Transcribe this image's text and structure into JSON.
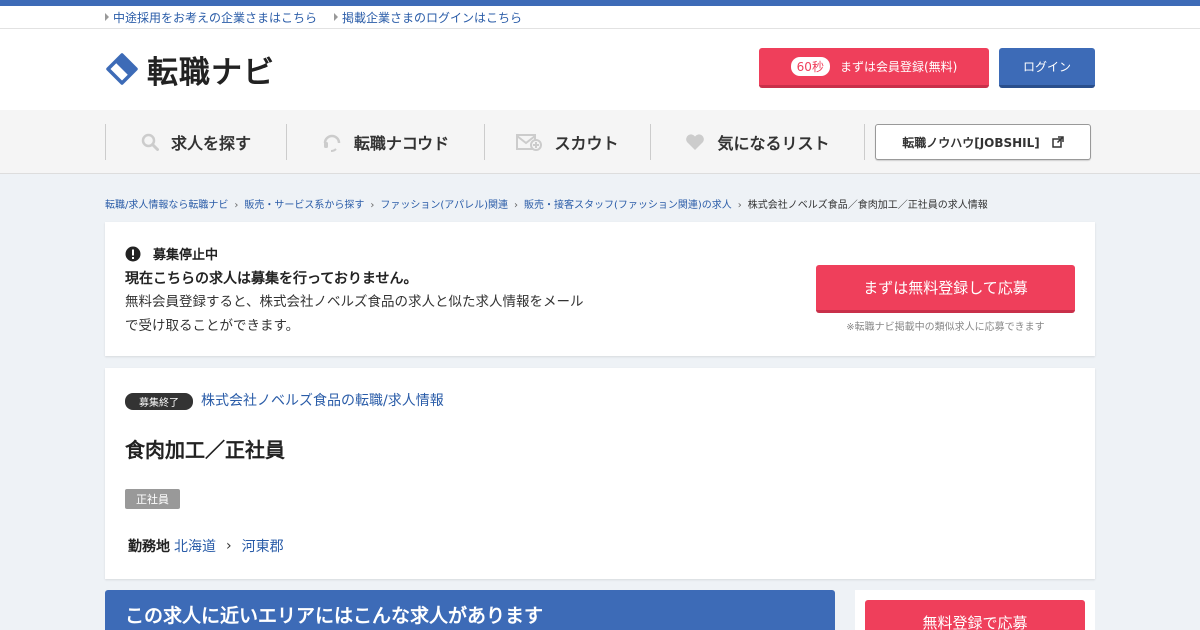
{
  "utility": {
    "links": [
      "中途採用をお考えの企業さまはこちら",
      "掲載企業さまのログインはこちら"
    ]
  },
  "header": {
    "logo_text": "転職ナビ",
    "register_badge": "60秒",
    "register_label": "まずは会員登録(無料)",
    "login_label": "ログイン"
  },
  "nav": {
    "items": [
      {
        "label": "求人を探す",
        "icon": "search-icon"
      },
      {
        "label": "転職ナコウド",
        "icon": "headset-icon"
      },
      {
        "label": "スカウト",
        "icon": "mail-plus-icon"
      },
      {
        "label": "気になるリスト",
        "icon": "heart-icon"
      }
    ],
    "jobshil_label": "転職ノウハウ[JOBSHIL]"
  },
  "breadcrumb": {
    "items": [
      "転職/求人情報なら転職ナビ",
      "販売・サービス系から探す",
      "ファッション(アパレル)関連",
      "販売・接客スタッフ(ファッション関連)の求人"
    ],
    "current": "株式会社ノベルズ食品／食肉加工／正社員の求人情報"
  },
  "notice": {
    "status": "募集停止中",
    "heading": "現在こちらの求人は募集を行っておりません。",
    "body": "無料会員登録すると、株式会社ノベルズ食品の求人と似た求人情報をメールで受け取ることができます。",
    "apply_button": "まずは無料登録して応募",
    "apply_note": "※転職ナビ掲載中の類似求人に応募できます"
  },
  "job": {
    "ended_badge": "募集終了",
    "company_link": "株式会社ノベルズ食品の転職/求人情報",
    "title": "食肉加工／正社員",
    "employment_type": "正社員",
    "location_label": "勤務地",
    "prefecture": "北海道",
    "city": "河東郡"
  },
  "nearby": {
    "title": "この求人に近いエリアにはこんな求人があります",
    "side_button": "無料登録で応募"
  },
  "colors": {
    "brand_blue": "#3d6bb7",
    "accent_red": "#ef3f5b"
  }
}
